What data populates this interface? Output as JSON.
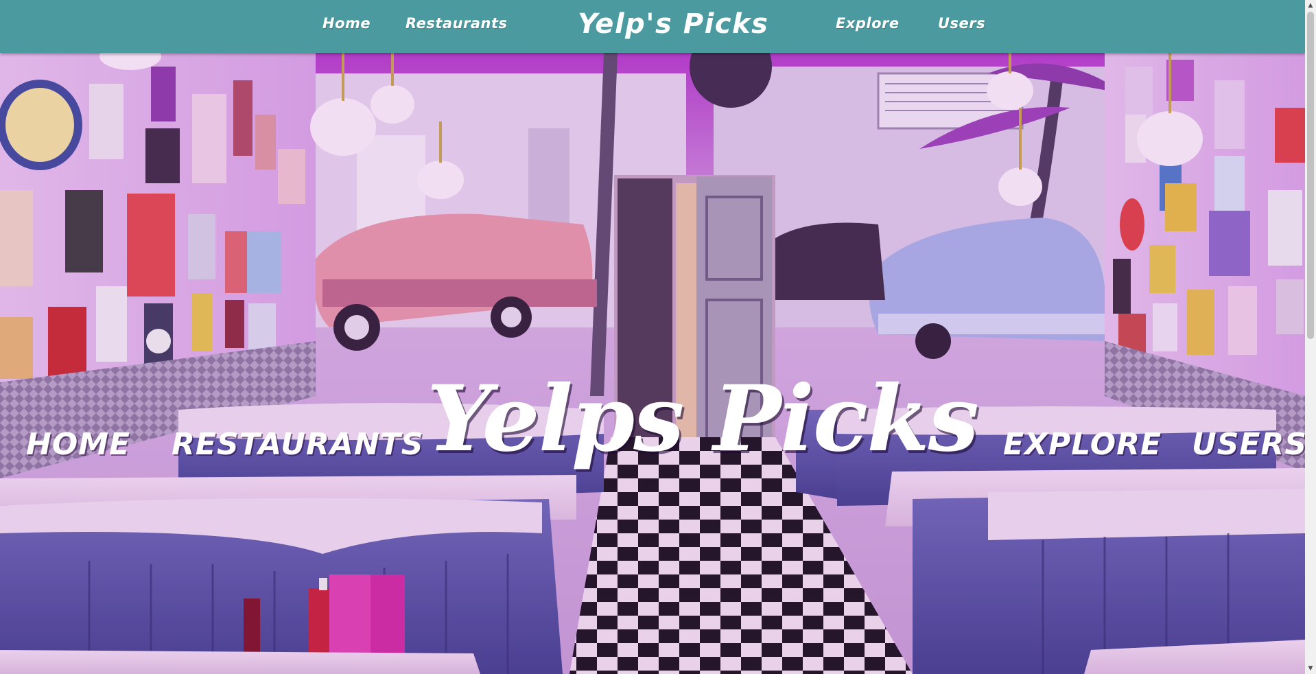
{
  "topnav": {
    "links_left": [
      "Home",
      "Restaurants"
    ],
    "brand": "Yelp's Picks",
    "links_right": [
      "Explore",
      "Users"
    ],
    "bg_color": "#4a9a9f"
  },
  "hero": {
    "title": "Yelps Picks",
    "links": [
      "HOME",
      "RESTAURANTS",
      "EXPLORE",
      "USERS"
    ],
    "image_description_icon": "retro-diner-photo"
  },
  "colors": {
    "accent": "#4a9a9f",
    "booth": "#5a5aa8",
    "tint": "#c060d0"
  }
}
